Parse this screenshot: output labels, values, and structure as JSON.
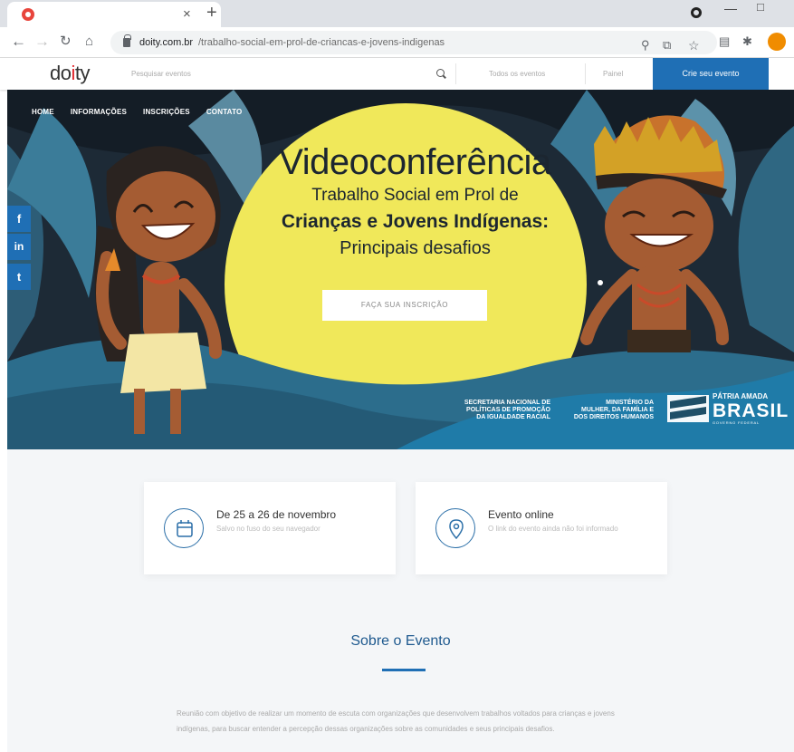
{
  "browser": {
    "tab_title": "",
    "tab_close": "×",
    "new_tab": "+",
    "url_domain": "doity.com.br",
    "url_path": "/trabalho-social-em-prol-de-criancas-e-jovens-indigenas",
    "profile_initial": "",
    "icons": [
      "back-arrow",
      "forward-arrow",
      "reload",
      "home",
      "lock",
      "zoom",
      "share",
      "star",
      "reading-list",
      "extensions",
      "profile"
    ]
  },
  "site_header": {
    "logo": "doity",
    "search_placeholder": "Pesquisar eventos",
    "all_events": "Todos os eventos",
    "panel": "Painel",
    "create_event": "Crie seu evento"
  },
  "hero": {
    "nav": [
      "HOME",
      "INFORMAÇÕES",
      "INSCRIÇÕES",
      "CONTATO"
    ],
    "title": "Videoconferência",
    "subtitle_1": "Trabalho Social em Prol de",
    "subtitle_2": "Crianças e Jovens Indígenas:",
    "subtitle_3": "Principais desafios",
    "cta": "FAÇA SUA INSCRIÇÃO",
    "logo_1": "SECRETARIA NACIONAL DE\nPOLÍTICAS DE PROMOÇÃO\nDA IGUALDADE RACIAL",
    "logo_2": "MINISTÉRIO DA\nMULHER, DA FAMÍLIA E\nDOS DIREITOS HUMANOS",
    "brasil_top": "PÁTRIA AMADA",
    "brasil_main": "BRASIL",
    "brasil_sub": "GOVERNO FEDERAL",
    "accent_color": "#f0e85a"
  },
  "social": {
    "facebook": "f",
    "linkedin": "in",
    "twitter": "t"
  },
  "cards": {
    "date_title": "De 25 a 26 de novembro",
    "date_sub": "Salvo no fuso do seu navegador",
    "online_title": "Evento online",
    "online_sub": "O link do evento ainda não foi informado"
  },
  "about": {
    "title": "Sobre o Evento",
    "text": "Reunião com objetivo de realizar um momento de escuta com organizações que desenvolvem trabalhos voltados para crianças e jovens indígenas, para buscar entender a percepção dessas organizações sobre as comunidades e seus principais desafios."
  }
}
